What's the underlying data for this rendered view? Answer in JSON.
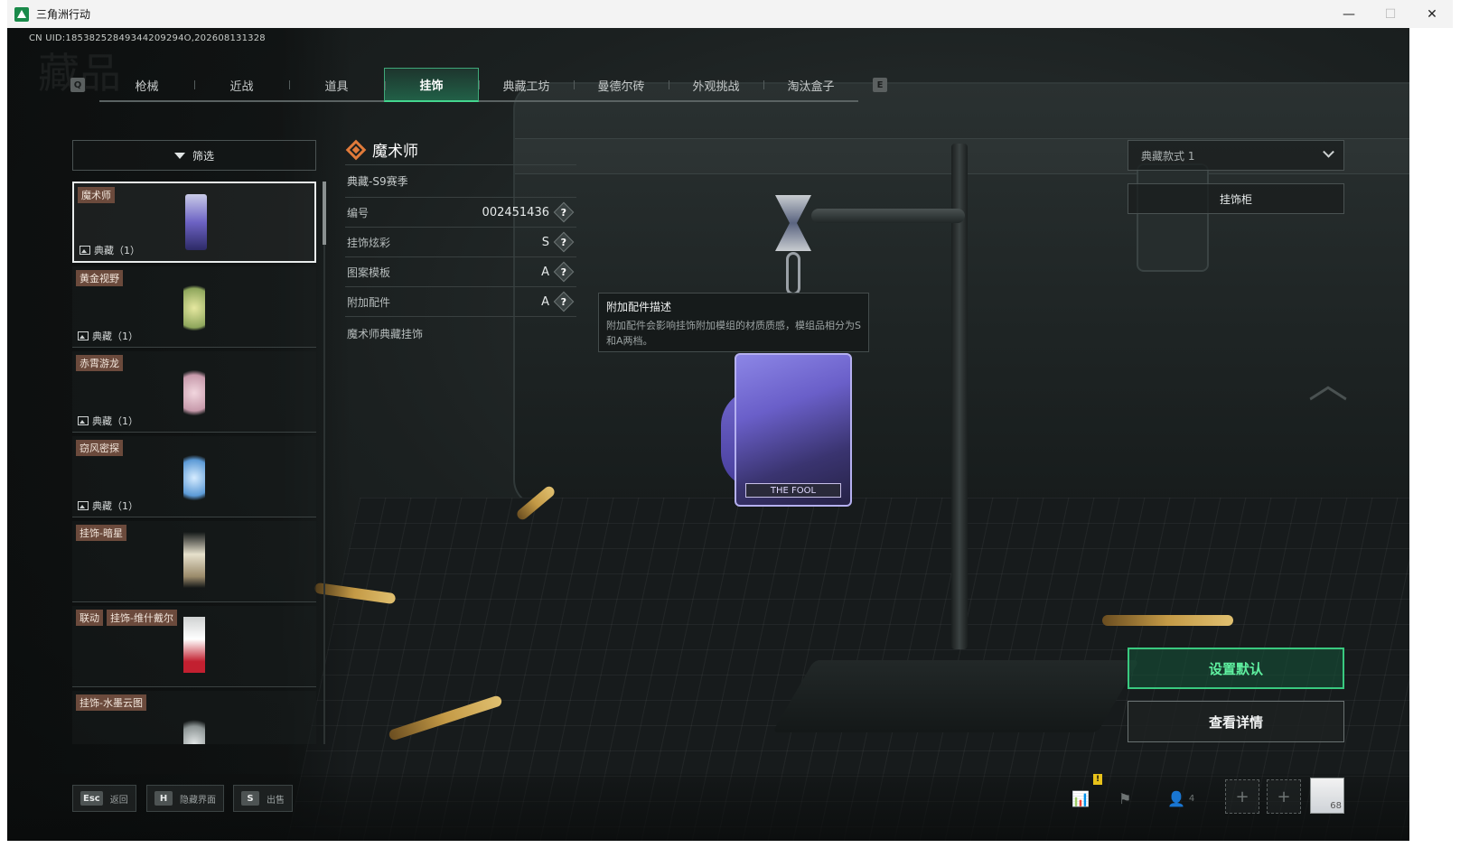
{
  "window": {
    "title": "三角洲行动",
    "controls": {
      "minimize": "—",
      "maximize": "☐",
      "close": "✕"
    }
  },
  "uid_text": "CN UID:18538252849344209294O,202608131328",
  "watermark": "藏品",
  "tabs": {
    "prev_key": "Q",
    "next_key": "E",
    "items": [
      {
        "label": "枪械",
        "active": false
      },
      {
        "label": "近战",
        "active": false
      },
      {
        "label": "道具",
        "active": false
      },
      {
        "label": "挂饰",
        "active": true
      },
      {
        "label": "典藏工坊",
        "active": false
      },
      {
        "label": "曼德尔砖",
        "active": false
      },
      {
        "label": "外观挑战",
        "active": false
      },
      {
        "label": "淘汰盒子",
        "active": false
      }
    ]
  },
  "filter": {
    "label": "筛选",
    "icon": "funnel-icon"
  },
  "charm_list": [
    {
      "name": "魔术师",
      "count": "典藏（1）",
      "selected": true
    },
    {
      "name": "黄金视野",
      "count": "典藏（1）",
      "selected": false
    },
    {
      "name": "赤霄游龙",
      "count": "典藏（1）",
      "selected": false
    },
    {
      "name": "窃风密探",
      "count": "典藏（1）",
      "selected": false
    },
    {
      "name": "挂饰-暗星",
      "count": "",
      "selected": false
    },
    {
      "collab": "联动",
      "name": "挂饰-维什戴尔",
      "count": "",
      "selected": false
    },
    {
      "name": "挂饰-水墨云图",
      "count": "",
      "selected": false
    }
  ],
  "detail": {
    "title": "魔术师",
    "season": "典藏-S9赛季",
    "rows": [
      {
        "label": "编号",
        "value": "002451436"
      },
      {
        "label": "挂饰炫彩",
        "value": "S"
      },
      {
        "label": "图案模板",
        "value": "A"
      },
      {
        "label": "附加配件",
        "value": "A"
      }
    ],
    "description": "魔术师典藏挂饰",
    "help_glyph": "?"
  },
  "tooltip": {
    "title": "附加配件描述",
    "body": "附加配件会影响挂饰附加模组的材质质感，模组品相分为S和A两档。"
  },
  "showcase": {
    "card_label": "THE FOOL"
  },
  "style_dropdown": {
    "value": "典藏款式 1"
  },
  "cabinet_button": "挂饰柜",
  "set_default_button": "设置默认",
  "view_details_button": "查看详情",
  "bottom_hints": [
    {
      "key": "Esc",
      "label": "返回"
    },
    {
      "key": "H",
      "label": "隐藏界面"
    },
    {
      "key": "S",
      "label": "出售"
    }
  ],
  "status": {
    "warning": "!",
    "friends_count": "4",
    "slot_glyph": "+",
    "avatar_level": "68"
  },
  "colors": {
    "accent_green": "#39c97f",
    "tag_brown": "#6b4a3c",
    "title_diamond": "#e07a3a"
  }
}
